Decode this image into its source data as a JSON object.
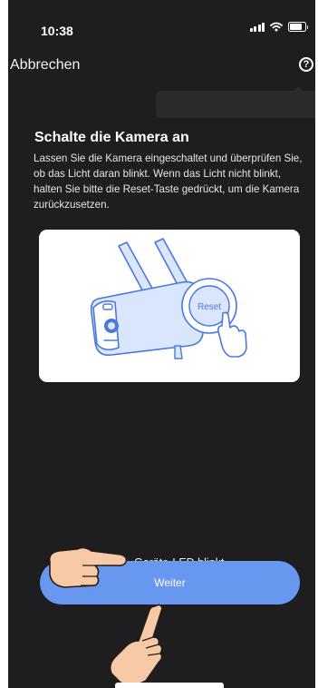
{
  "status_bar": {
    "time": "10:38",
    "signal_icon": "cellular-signal-icon",
    "wifi_icon": "wifi-icon",
    "battery_icon": "battery-icon"
  },
  "header": {
    "cancel_label": "Abbrechen",
    "help_icon": "help-circle-icon",
    "help_symbol": "?"
  },
  "content": {
    "title": "Schalte die Kamera an",
    "description": "Lassen Sie die Kamera eingeschaltet und überprüfen Sie, ob das Licht daran blinkt. Wenn das Licht nicht blinkt, halten Sie bitte die Reset-Taste gedrückt, um die Kamera zurückzusetzen.",
    "illustration": {
      "camera_icon": "security-camera-icon",
      "reset_label": "Reset",
      "pointer_icon": "pointing-hand-icon"
    }
  },
  "confirm": {
    "checkbox_label": "Geräte-LED blinkt",
    "checked": true
  },
  "actions": {
    "next_label": "Weiter"
  },
  "colors": {
    "background": "#1e1e20",
    "accent": "#6797ef",
    "illustration_line": "#4b78df",
    "illustration_fill": "#d9e6fb"
  }
}
